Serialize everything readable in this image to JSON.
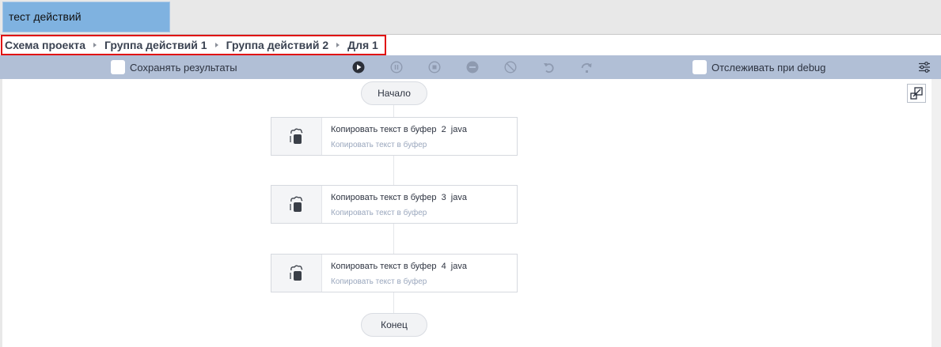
{
  "tab": {
    "label": "тест действий"
  },
  "breadcrumb": [
    "Схема проекта",
    "Группа действий 1",
    "Группа действий 2",
    "Для 1"
  ],
  "toolbar": {
    "save_results_label": "Сохранять результаты",
    "track_debug_label": "Отслеживать при debug",
    "buttons": [
      "play-icon",
      "pause-icon",
      "stop-icon",
      "minus-circle-icon",
      "cancel-icon",
      "undo-icon",
      "redo-icon"
    ]
  },
  "flow": {
    "start_label": "Начало",
    "end_label": "Конец",
    "nodes": [
      {
        "title": "Копировать текст в буфер  2  java",
        "subtitle": "Копировать текст в буфер"
      },
      {
        "title": "Копировать текст в буфер  3  java",
        "subtitle": "Копировать текст в буфер"
      },
      {
        "title": "Копировать текст в буфер  4  java",
        "subtitle": "Копировать текст в буфер"
      }
    ]
  },
  "colors": {
    "tab_active": "#7fb2e0",
    "toolbar": "#b1bfd6",
    "highlight": "#e01010",
    "subtitle": "#9aa7bd"
  }
}
